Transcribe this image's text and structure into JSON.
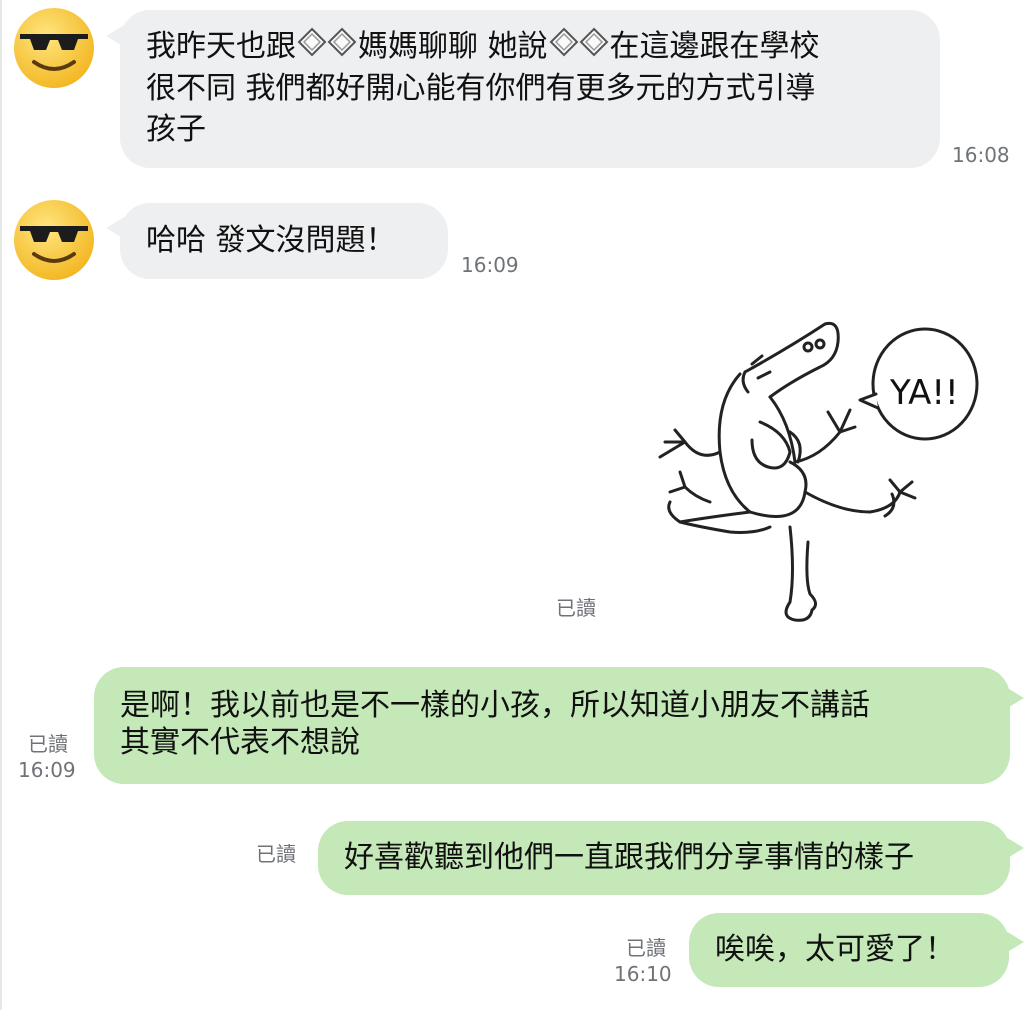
{
  "messages": [
    {
      "sender": "friend",
      "avatar": "sunglasses-emoji-avatar",
      "text_line1_a": "我昨天也跟",
      "text_line1_b": "媽媽聊聊 她說",
      "text_line1_c": "在這邊跟在學校",
      "text_line2": "很不同 我們都好開心能有你們有更多元的方式引導",
      "text_line3": "孩子",
      "time": "16:08"
    },
    {
      "sender": "friend",
      "avatar": "sunglasses-emoji-avatar",
      "text": "哈哈 發文沒問題！",
      "time": "16:09"
    },
    {
      "sender": "me",
      "type": "sticker",
      "sticker_text": "YA!!",
      "read": "已讀"
    },
    {
      "sender": "me",
      "text_line1": "是啊！我以前也是不一樣的小孩，所以知道小朋友不講話",
      "text_line2": "其實不代表不想說",
      "read": "已讀",
      "time": "16:09"
    },
    {
      "sender": "me",
      "text": "好喜歡聽到他們一直跟我們分享事情的樣子",
      "read": "已讀"
    },
    {
      "sender": "me",
      "text": "唉唉，太可愛了！",
      "read": "已讀",
      "time": "16:10"
    }
  ],
  "colors": {
    "incoming_bubble": "#eeeff1",
    "outgoing_bubble": "#c4e8b7",
    "meta_text": "#6f7378"
  }
}
